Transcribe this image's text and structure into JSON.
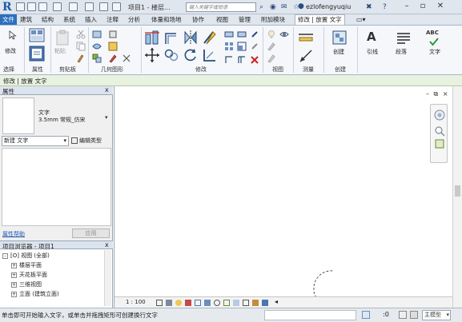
{
  "title_bar": {
    "logo": "R",
    "title": "项目1 - 楼层...",
    "search_placeholder": "键入关键字或短语",
    "username": "ezlofengyuqiu",
    "close_glyph": "✕"
  },
  "tabs": [
    "文件",
    "建筑",
    "结构",
    "系统",
    "插入",
    "注释",
    "分析",
    "体量和场地",
    "协作",
    "视图",
    "管理",
    "附加模块",
    "修改 | 放置 文字"
  ],
  "ribbon": {
    "panels": {
      "select": "选择",
      "properties": "属性",
      "clipboard": "剪贴板",
      "geometry": "几何图形",
      "modify": "修改",
      "view": "视图",
      "measure": "测量",
      "create": "创建"
    },
    "buttons": {
      "modify": "修改",
      "paste": "粘贴",
      "create": "创建",
      "leader": "引线",
      "paragraph": "段落",
      "text": "文字"
    }
  },
  "context_bar": {
    "label": "修改 | 放置 文字"
  },
  "properties": {
    "header": "属性",
    "close_glyph": "x",
    "type_name": "文字",
    "type_sub": "3.5mm 常规_仿宋",
    "instance_filter": "新建 文字",
    "edit_type": "编辑类型",
    "help_link": "属性帮助",
    "apply": "应用"
  },
  "browser": {
    "header": "项目浏览器 - 项目1",
    "close_glyph": "x",
    "items": [
      {
        "pm": "-",
        "label": "[O] 视图 (全部)"
      },
      {
        "pm": "+",
        "label": "楼层平面"
      },
      {
        "pm": "+",
        "label": "天花板平面"
      },
      {
        "pm": "+",
        "label": "三维视图"
      },
      {
        "pm": "+",
        "label": "立面 (建筑立面)"
      }
    ]
  },
  "viewbar": {
    "scale": "1 : 100"
  },
  "status": {
    "message": "单击即可开始输入文字，或单击并拖拽矩形可创建换行文字",
    "zero": ":0",
    "model": "主模型"
  }
}
